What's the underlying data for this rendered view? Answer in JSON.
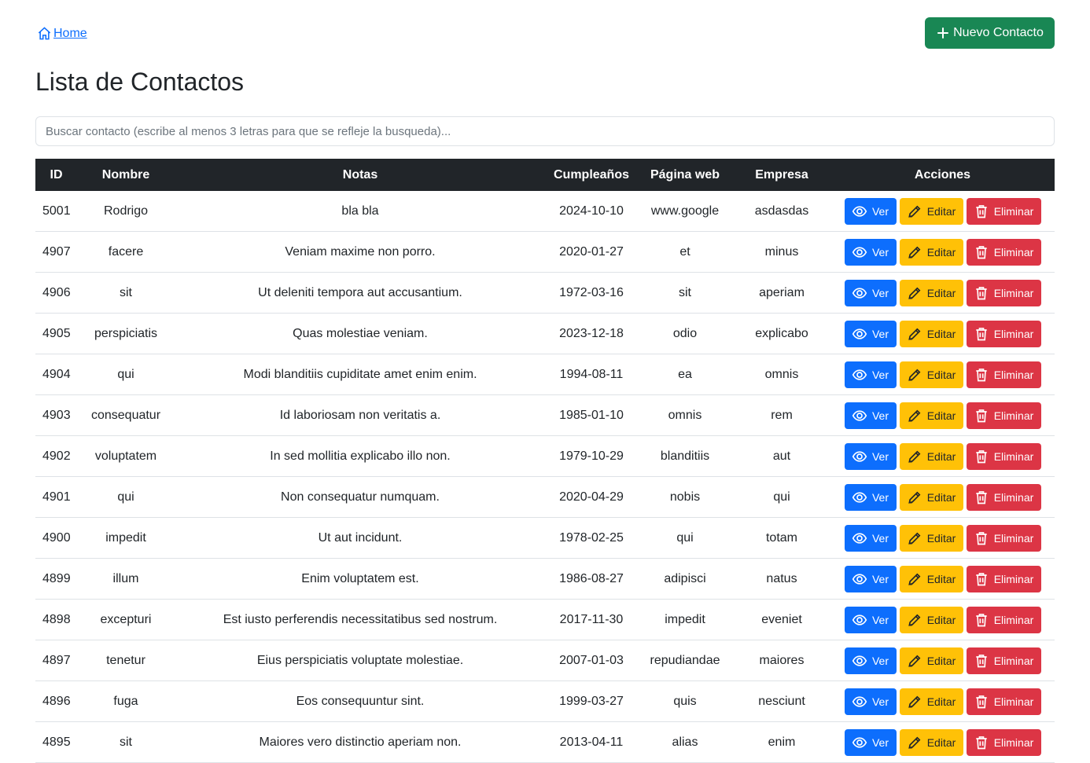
{
  "nav": {
    "home_label": "Home"
  },
  "header": {
    "new_button_label": "Nuevo Contacto"
  },
  "page": {
    "title": "Lista de Contactos"
  },
  "search": {
    "placeholder": "Buscar contacto (escribe al menos 3 letras para que se refleje la busqueda)...",
    "value": ""
  },
  "colors": {
    "primary": "#0d6efd",
    "success": "#198754",
    "warning": "#ffc107",
    "danger": "#dc3545",
    "header_bg": "#212529"
  },
  "icons": {
    "home": "house-icon",
    "new": "plus-icon",
    "view": "eye-icon",
    "edit": "pencil-icon",
    "delete": "trash-icon"
  },
  "table": {
    "columns": [
      "ID",
      "Nombre",
      "Notas",
      "Cumpleaños",
      "Página web",
      "Empresa",
      "Acciones"
    ],
    "actions": {
      "view": "Ver",
      "edit": "Editar",
      "delete": "Eliminar"
    },
    "rows": [
      {
        "id": "5001",
        "nombre": "Rodrigo",
        "notas": "bla bla",
        "cumple": "2024-10-10",
        "web": "www.google",
        "empresa": "asdasdas"
      },
      {
        "id": "4907",
        "nombre": "facere",
        "notas": "Veniam maxime non porro.",
        "cumple": "2020-01-27",
        "web": "et",
        "empresa": "minus"
      },
      {
        "id": "4906",
        "nombre": "sit",
        "notas": "Ut deleniti tempora aut accusantium.",
        "cumple": "1972-03-16",
        "web": "sit",
        "empresa": "aperiam"
      },
      {
        "id": "4905",
        "nombre": "perspiciatis",
        "notas": "Quas molestiae veniam.",
        "cumple": "2023-12-18",
        "web": "odio",
        "empresa": "explicabo"
      },
      {
        "id": "4904",
        "nombre": "qui",
        "notas": "Modi blanditiis cupiditate amet enim enim.",
        "cumple": "1994-08-11",
        "web": "ea",
        "empresa": "omnis"
      },
      {
        "id": "4903",
        "nombre": "consequatur",
        "notas": "Id laboriosam non veritatis a.",
        "cumple": "1985-01-10",
        "web": "omnis",
        "empresa": "rem"
      },
      {
        "id": "4902",
        "nombre": "voluptatem",
        "notas": "In sed mollitia explicabo illo non.",
        "cumple": "1979-10-29",
        "web": "blanditiis",
        "empresa": "aut"
      },
      {
        "id": "4901",
        "nombre": "qui",
        "notas": "Non consequatur numquam.",
        "cumple": "2020-04-29",
        "web": "nobis",
        "empresa": "qui"
      },
      {
        "id": "4900",
        "nombre": "impedit",
        "notas": "Ut aut incidunt.",
        "cumple": "1978-02-25",
        "web": "qui",
        "empresa": "totam"
      },
      {
        "id": "4899",
        "nombre": "illum",
        "notas": "Enim voluptatem est.",
        "cumple": "1986-08-27",
        "web": "adipisci",
        "empresa": "natus"
      },
      {
        "id": "4898",
        "nombre": "excepturi",
        "notas": "Est iusto perferendis necessitatibus sed nostrum.",
        "cumple": "2017-11-30",
        "web": "impedit",
        "empresa": "eveniet"
      },
      {
        "id": "4897",
        "nombre": "tenetur",
        "notas": "Eius perspiciatis voluptate molestiae.",
        "cumple": "2007-01-03",
        "web": "repudiandae",
        "empresa": "maiores"
      },
      {
        "id": "4896",
        "nombre": "fuga",
        "notas": "Eos consequuntur sint.",
        "cumple": "1999-03-27",
        "web": "quis",
        "empresa": "nesciunt"
      },
      {
        "id": "4895",
        "nombre": "sit",
        "notas": "Maiores vero distinctio aperiam non.",
        "cumple": "2013-04-11",
        "web": "alias",
        "empresa": "enim"
      }
    ]
  }
}
